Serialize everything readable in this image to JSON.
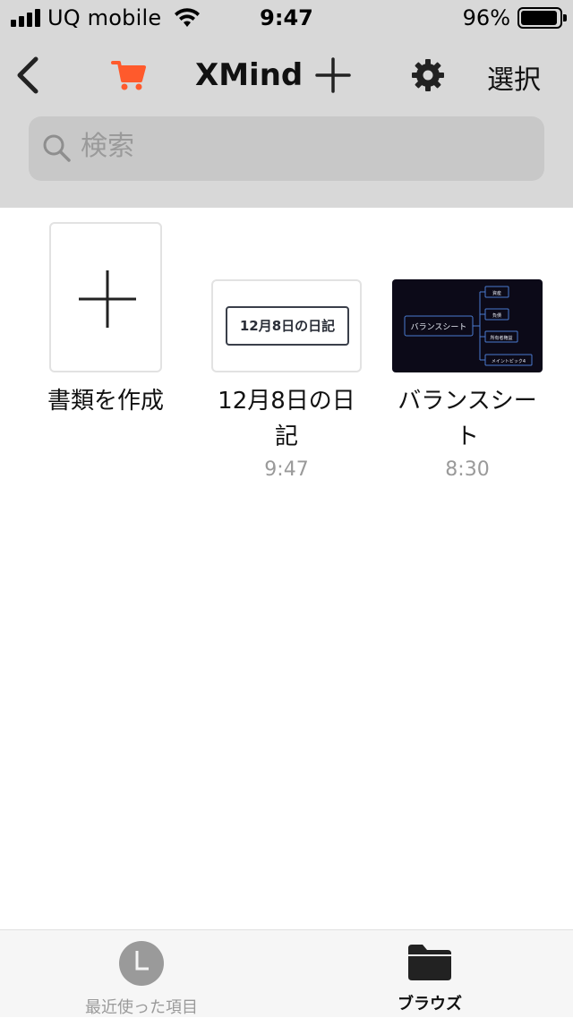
{
  "status_bar": {
    "carrier": "UQ mobile",
    "time": "9:47",
    "battery": "96%",
    "battery_level": 0.96
  },
  "nav": {
    "title": "XMind",
    "select_label": "選択"
  },
  "search": {
    "placeholder": "検索"
  },
  "tiles": {
    "create": {
      "label": "書類を作成"
    },
    "diary": {
      "label": "12月8日の日記",
      "time": "9:47",
      "preview_title": "12月8日の日記"
    },
    "balance": {
      "label": "バランスシート",
      "time": "8:30",
      "preview_root": "バランスシート",
      "preview_branches": [
        "資産",
        "負債",
        "所有者権益",
        "メイントピック4"
      ]
    }
  },
  "tabbar": {
    "recent_label": "最近使った項目",
    "browse_label": "ブラウズ"
  },
  "colors": {
    "accent_cart": "#ff5a2c",
    "nav_bg": "#d8d8d8",
    "thumb_dark": "#0c0a18",
    "branch_blue": "#4a7bd0"
  }
}
